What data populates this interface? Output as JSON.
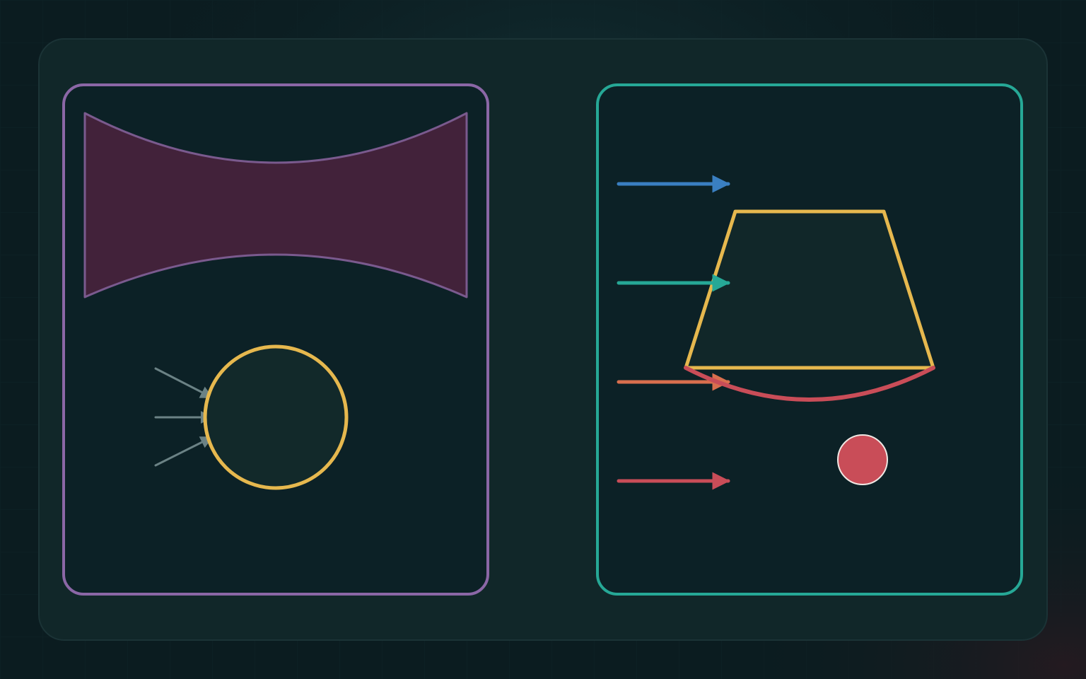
{
  "colors": {
    "background": "#0b1c20",
    "card": "#112729",
    "card_border": "#1b3336",
    "panel_fill": "#0c2126",
    "left_panel_border": "#8b67a6",
    "right_panel_border": "#26a896",
    "lens_fill": "#42223a",
    "lens_stroke": "#7a5a8e",
    "circle_stroke": "#e6b84e",
    "circle_fill": "#12292a",
    "ray_gray": "#6b8285",
    "ray_blue": "#3a7fc1",
    "ray_teal": "#26a896",
    "ray_orange": "#d96f4e",
    "ray_red": "#c94d58",
    "prism_stroke": "#e6b84e",
    "prism_fill": "#112729",
    "arc_red": "#c94d58",
    "dot_fill": "#c94d58",
    "dot_stroke": "#f0e8e4"
  },
  "icons": {
    "ray_arrowhead": "triangle-arrowhead"
  },
  "left_panel": {
    "lens": {
      "shape": "concave-lens"
    },
    "circle": {
      "shape": "circle-outline"
    },
    "incoming_rays": [
      {
        "color_key": "ray_gray"
      },
      {
        "color_key": "ray_gray"
      },
      {
        "color_key": "ray_gray"
      }
    ]
  },
  "right_panel": {
    "rays": [
      {
        "color_key": "ray_blue"
      },
      {
        "color_key": "ray_teal"
      },
      {
        "color_key": "ray_orange"
      },
      {
        "color_key": "ray_red"
      }
    ],
    "prism": {
      "shape": "trapezoid-outline"
    },
    "arc": {
      "shape": "curved-base"
    },
    "dot": {
      "shape": "filled-circle"
    }
  }
}
